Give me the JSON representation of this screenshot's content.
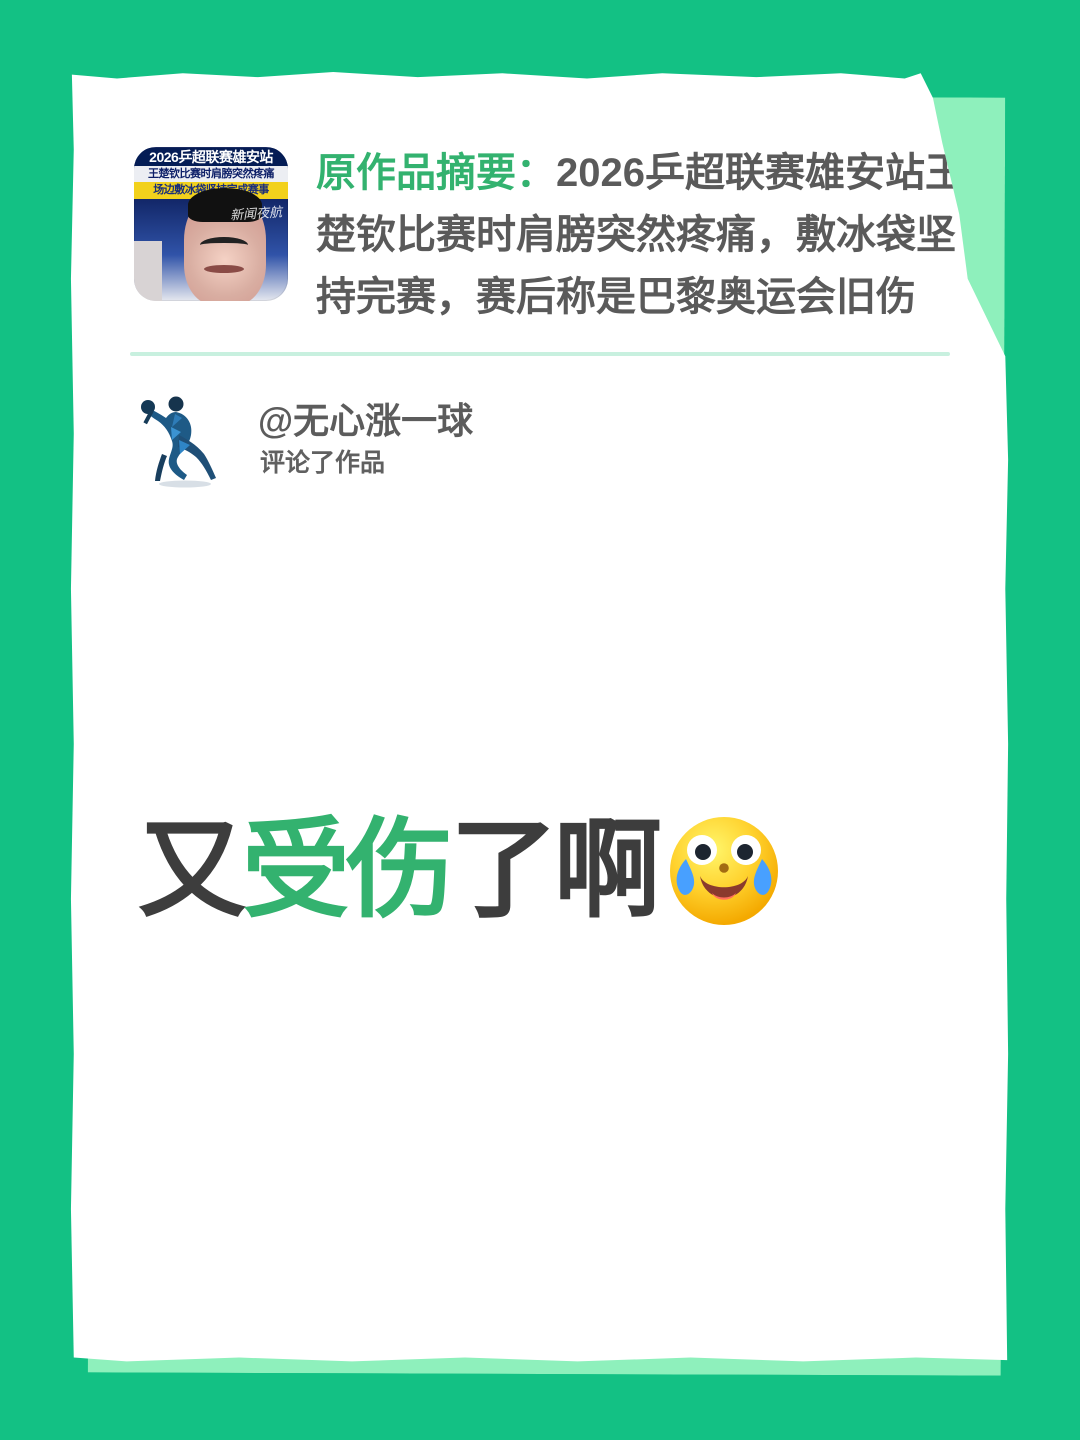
{
  "thumbnail": {
    "title": "2026乒超联赛雄安站",
    "headline": "王楚钦比赛时肩膀突然疼痛",
    "subheadline": "场边敷冰袋坚持完成赛事",
    "watermark": "新闻夜航"
  },
  "summary": {
    "label": "原作品摘要：",
    "text": "2026乒超联赛雄安站王楚钦比赛时肩膀突然疼痛，敷冰袋坚持完赛，赛后称是巴黎奥运会旧伤"
  },
  "user": {
    "name": "@无心涨一球",
    "action": "评论了作品",
    "avatar_icon": "table-tennis-player-icon"
  },
  "comment": {
    "parts": [
      {
        "text": "又",
        "color": "#3d3d3d"
      },
      {
        "text": "受伤",
        "color": "#33b26f"
      },
      {
        "text": "了啊",
        "color": "#3d3d3d"
      }
    ],
    "emoji": "crying-laughing-emoji-icon"
  },
  "colors": {
    "background": "#13c184",
    "paper": "#ffffff",
    "accent": "#33b26f",
    "text_dark": "#3d3d3d",
    "text_gray": "#5c5c5c",
    "divider": "#c8f0df"
  }
}
